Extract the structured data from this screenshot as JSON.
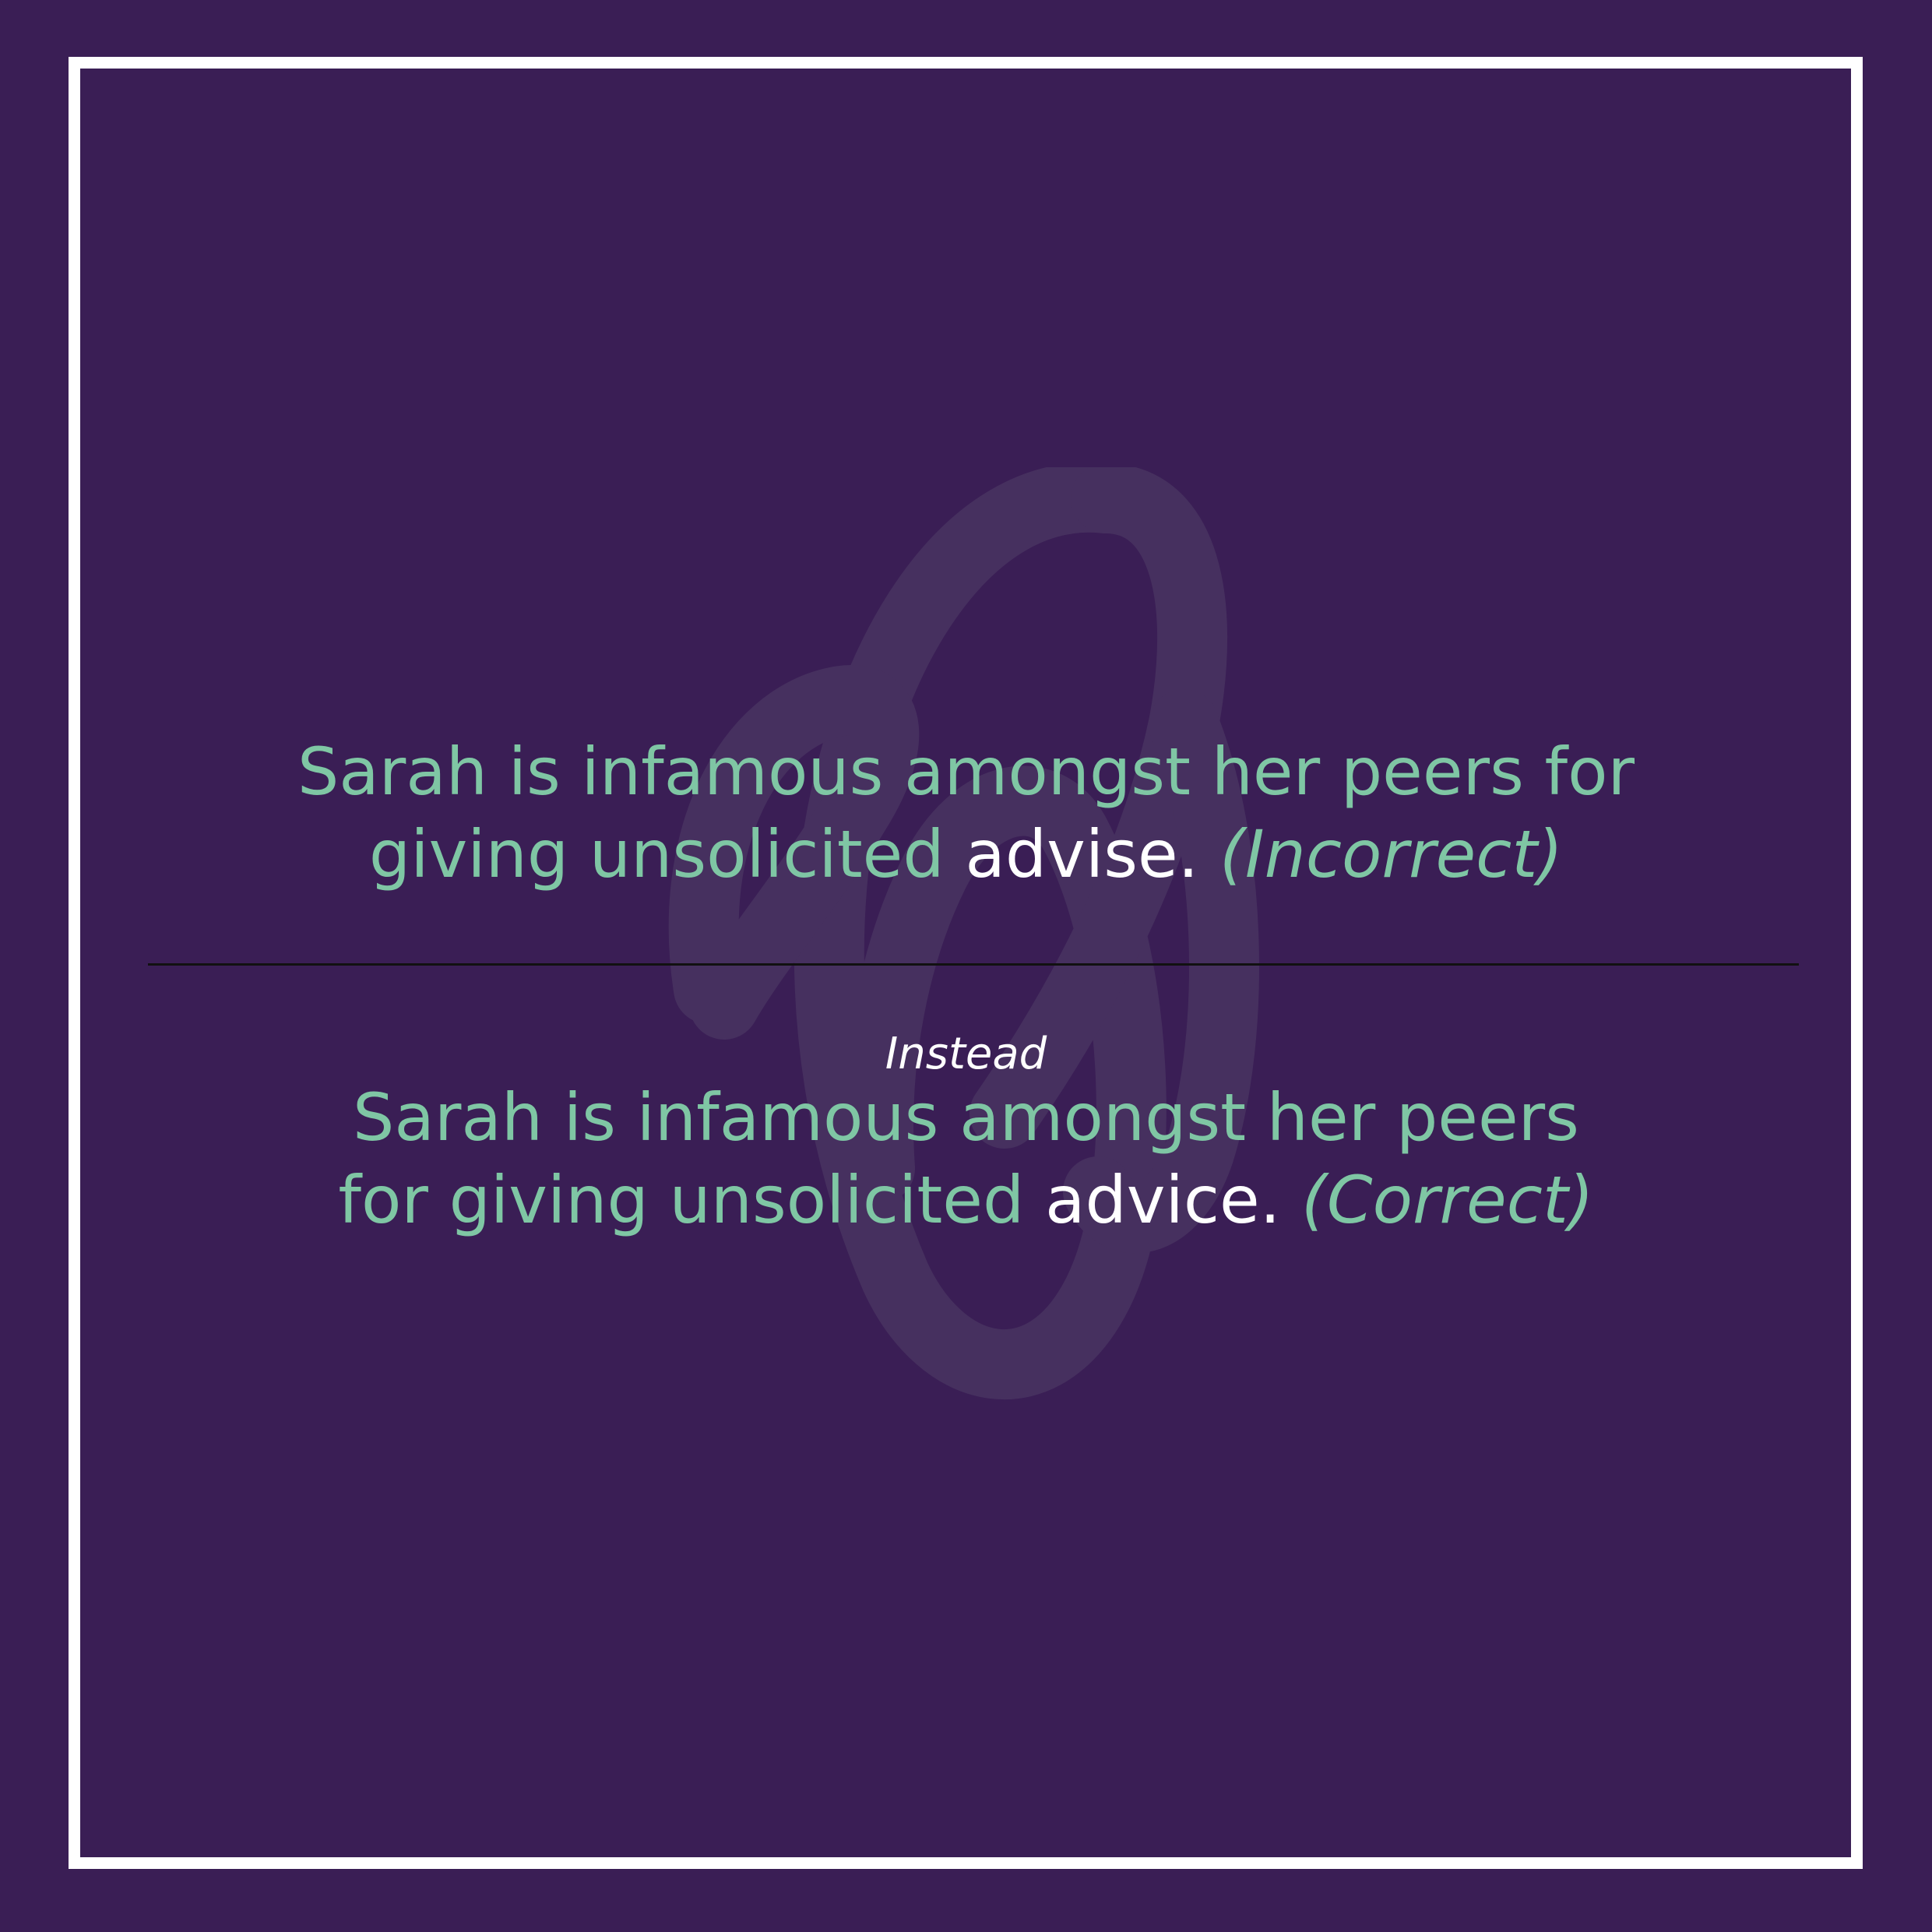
{
  "card": {
    "background": "#3a1e55",
    "border_color": "#ffffff",
    "text_color": "#7fc6a4",
    "highlight_color": "#ffffff",
    "watermark_icon": "cursive-g-logo-icon"
  },
  "incorrect": {
    "line1": "Sarah is infamous amongst her peers for",
    "line2_before": "giving unsolicited ",
    "highlight": "advise.",
    "verdict": "(Incorrect)"
  },
  "separator": {
    "label": "Instead"
  },
  "correct": {
    "line1": "Sarah is infamous amongst her peers",
    "line2_before": "for giving unsolicited ",
    "highlight": "advice.",
    "verdict": "(Correct)"
  }
}
